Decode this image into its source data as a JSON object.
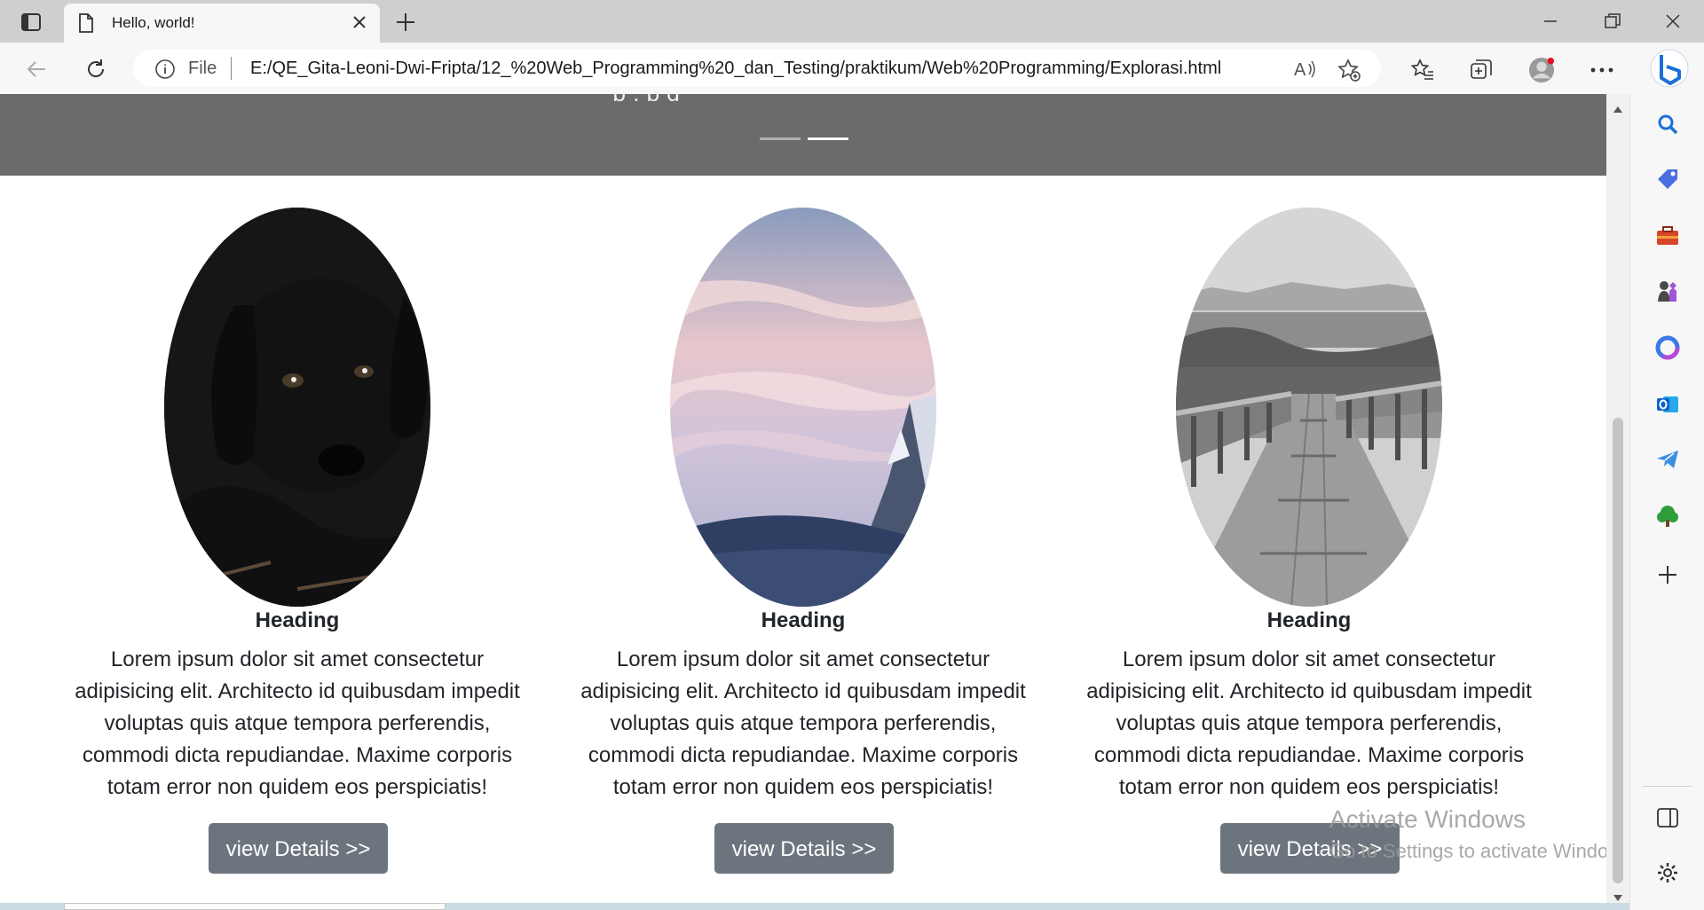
{
  "browser": {
    "tab_title": "Hello, world!",
    "address_scheme": "File",
    "address_url": "E:/QE_Gita-Leoni-Dwi-Fripta/12_%20Web_Programming%20_dan_Testing/praktikum/Web%20Programming/Explorasi.html"
  },
  "hero": {
    "caption_partial": "p                          ,                  p     g",
    "active_slide": 2,
    "slide_count": 2
  },
  "columns": [
    {
      "image": "black-puppy",
      "heading": "Heading",
      "text": "Lorem ipsum dolor sit amet consectetur adipisicing elit. Architecto id quibusdam impedit voluptas quis atque tempora perferendis, commodi dicta repudiandae. Maxime corporis totam error non quidem eos perspiciatis!",
      "button": "view Details >>"
    },
    {
      "image": "mountain-sunset",
      "heading": "Heading",
      "text": "Lorem ipsum dolor sit amet consectetur adipisicing elit. Architecto id quibusdam impedit voluptas quis atque tempora perferendis, commodi dicta repudiandae. Maxime corporis totam error non quidem eos perspiciatis!",
      "button": "view Details >>"
    },
    {
      "image": "wooden-bridge",
      "heading": "Heading",
      "text": "Lorem ipsum dolor sit amet consectetur adipisicing elit. Architecto id quibusdam impedit voluptas quis atque tempora perferendis, commodi dicta repudiandae. Maxime corporis totam error non quidem eos perspiciatis!",
      "button": "view Details >>"
    }
  ],
  "watermark": {
    "line1": "Activate Windows",
    "line2": "Go to Settings to activate Windows."
  },
  "sidebar_icons": [
    "search-icon",
    "tag-icon",
    "toolbox-icon",
    "games-icon",
    "office-icon",
    "outlook-icon",
    "telegram-icon",
    "tree-icon",
    "add-icon"
  ],
  "colors": {
    "hero_bg": "#6b6b6b",
    "button_bg": "#6c757d",
    "tab_bar": "#cfcfcf"
  }
}
